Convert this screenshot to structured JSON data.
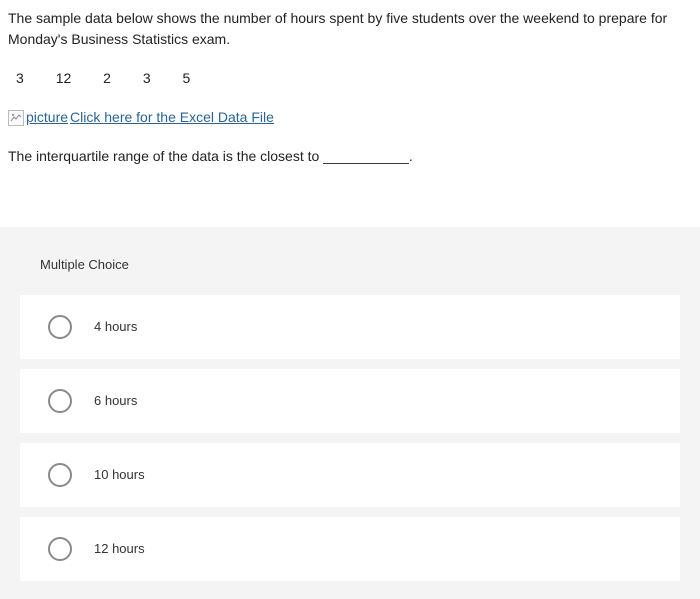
{
  "question": {
    "prompt": "The sample data below shows the number of hours spent by five students over the weekend to prepare for Monday's Business Statistics exam.",
    "data_values": [
      "3",
      "12",
      "2",
      "3",
      "5"
    ],
    "excel_alt": "picture",
    "excel_link_text": "Click here for the Excel Data File",
    "fill_sentence_before": "The interquartile range of the data is the closest to ",
    "fill_blank": "___________",
    "fill_sentence_after": "."
  },
  "answers": {
    "header": "Multiple Choice",
    "options": [
      {
        "label": "4 hours"
      },
      {
        "label": "6 hours"
      },
      {
        "label": "10 hours"
      },
      {
        "label": "12 hours"
      }
    ]
  }
}
